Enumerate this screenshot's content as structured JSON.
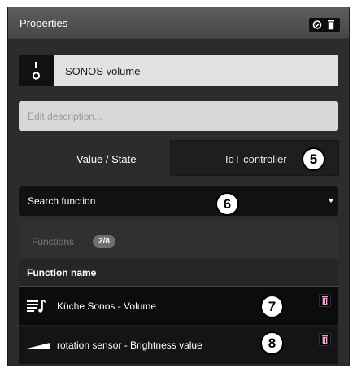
{
  "header": {
    "title": "Properties",
    "buttons": [
      {
        "icon": "check-circle-icon"
      },
      {
        "icon": "trash-icon"
      }
    ]
  },
  "name_field": {
    "icon": "slider-toggle-icon",
    "value": "SONOS volume"
  },
  "description": {
    "placeholder": "Edit description...",
    "value": ""
  },
  "value_state": {
    "label": "Value / State",
    "button_label": "IoT controller",
    "callout": "5"
  },
  "search_function": {
    "label": "Search function",
    "callout": "6"
  },
  "functions": {
    "tab_label": "Functions",
    "badge": "2/8",
    "column_header": "Function name",
    "rows": [
      {
        "icon": "music-list-icon",
        "label": "Küche Sonos - Volume",
        "callout": "7"
      },
      {
        "icon": "signal-ramp-icon",
        "label": "rotation sensor - Brightness value",
        "callout": "8"
      }
    ]
  },
  "colors": {
    "panel_background": "#2c2c2c",
    "delete_accent": "#e8a2cf"
  }
}
